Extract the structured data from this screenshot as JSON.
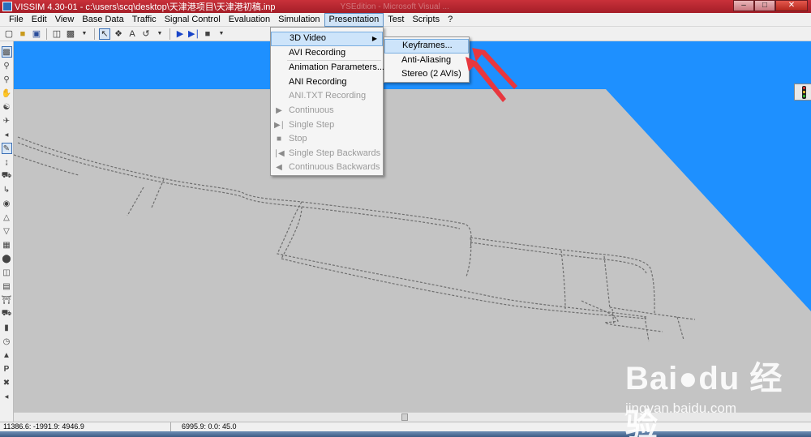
{
  "window": {
    "title": "VISSIM 4.30-01 - c:\\users\\scq\\desktop\\天津港项目\\天津港初稿.inp",
    "faded_title": "YSEdition - Microsoft Visual ...",
    "controls": {
      "minimize": "–",
      "maximize": "□",
      "close": "✕"
    }
  },
  "menubar": {
    "items": [
      {
        "label": "File"
      },
      {
        "label": "Edit"
      },
      {
        "label": "View"
      },
      {
        "label": "Base Data"
      },
      {
        "label": "Traffic"
      },
      {
        "label": "Signal Control"
      },
      {
        "label": "Evaluation"
      },
      {
        "label": "Simulation"
      },
      {
        "label": "Presentation"
      },
      {
        "label": "Test"
      },
      {
        "label": "Scripts"
      },
      {
        "label": "?"
      }
    ],
    "active": "Presentation"
  },
  "presentation_menu": {
    "items": [
      {
        "label": "3D Video",
        "has_submenu": true,
        "highlighted": true,
        "enabled": true
      },
      {
        "label": "AVI Recording",
        "enabled": true
      },
      {
        "label": "Animation Parameters...",
        "enabled": true
      },
      {
        "label": "ANI Recording",
        "enabled": true
      },
      {
        "label": "ANI.TXT Recording",
        "enabled": false
      },
      {
        "label": "Continuous",
        "enabled": false,
        "icon": "play-icon"
      },
      {
        "label": "Single Step",
        "enabled": false,
        "icon": "step-icon"
      },
      {
        "label": "Stop",
        "enabled": false,
        "icon": "stop-icon"
      },
      {
        "label": "Single Step Backwards",
        "enabled": false,
        "icon": "step-back-icon"
      },
      {
        "label": "Continuous Backwards",
        "enabled": false,
        "icon": "play-back-icon"
      }
    ]
  },
  "video_submenu": {
    "items": [
      {
        "label": "Keyframes...",
        "highlighted": true
      },
      {
        "label": "Anti-Aliasing"
      },
      {
        "label": "Stereo (2 AVIs)"
      }
    ]
  },
  "statusbar": {
    "coords": "11386.6: -1991.9: 4946.9",
    "camera": "6995.9: 0.0: 45.0"
  },
  "watermark": {
    "brand": "Bai●du 经验",
    "url": "jingyan.baidu.com"
  },
  "colors": {
    "viewport_bg": "#1e90ff",
    "ground": "#c4c4c4",
    "menu_highlight": "#cde4fa",
    "annotation_arrow": "#e8373e"
  }
}
